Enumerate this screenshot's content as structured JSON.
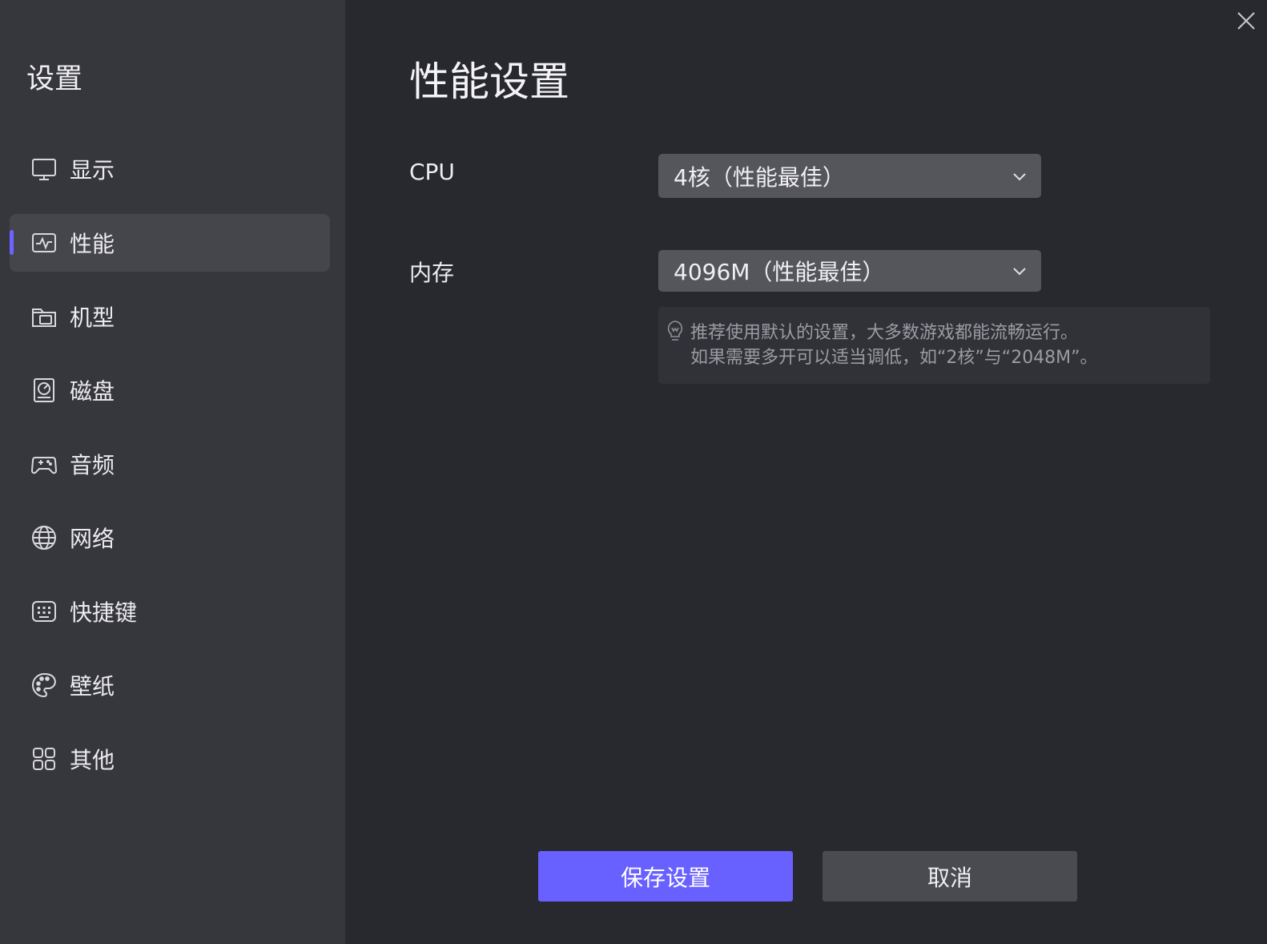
{
  "sidebar": {
    "title": "设置",
    "items": [
      {
        "label": "显示",
        "icon": "monitor-icon",
        "active": false
      },
      {
        "label": "性能",
        "icon": "pulse-icon",
        "active": true
      },
      {
        "label": "机型",
        "icon": "folder-icon",
        "active": false
      },
      {
        "label": "磁盘",
        "icon": "disk-icon",
        "active": false
      },
      {
        "label": "音频",
        "icon": "gamepad-icon",
        "active": false
      },
      {
        "label": "网络",
        "icon": "globe-icon",
        "active": false
      },
      {
        "label": "快捷键",
        "icon": "keyboard-icon",
        "active": false
      },
      {
        "label": "壁纸",
        "icon": "palette-icon",
        "active": false
      },
      {
        "label": "其他",
        "icon": "grid-icon",
        "active": false
      }
    ]
  },
  "main": {
    "title": "性能设置",
    "cpu": {
      "label": "CPU",
      "value": "4核（性能最佳）"
    },
    "memory": {
      "label": "内存",
      "value": "4096M（性能最佳）"
    },
    "tip": {
      "icon": "lightbulb-icon",
      "line1": "推荐使用默认的设置，大多数游戏都能流畅运行。",
      "line2": "如果需要多开可以适当调低，如“2核”与“2048M”。"
    }
  },
  "buttons": {
    "save": "保存设置",
    "cancel": "取消"
  },
  "colors": {
    "accent": "#6961ff",
    "sidebar_bg": "#36363d",
    "main_bg": "#28282f",
    "select_bg": "#55555c"
  }
}
